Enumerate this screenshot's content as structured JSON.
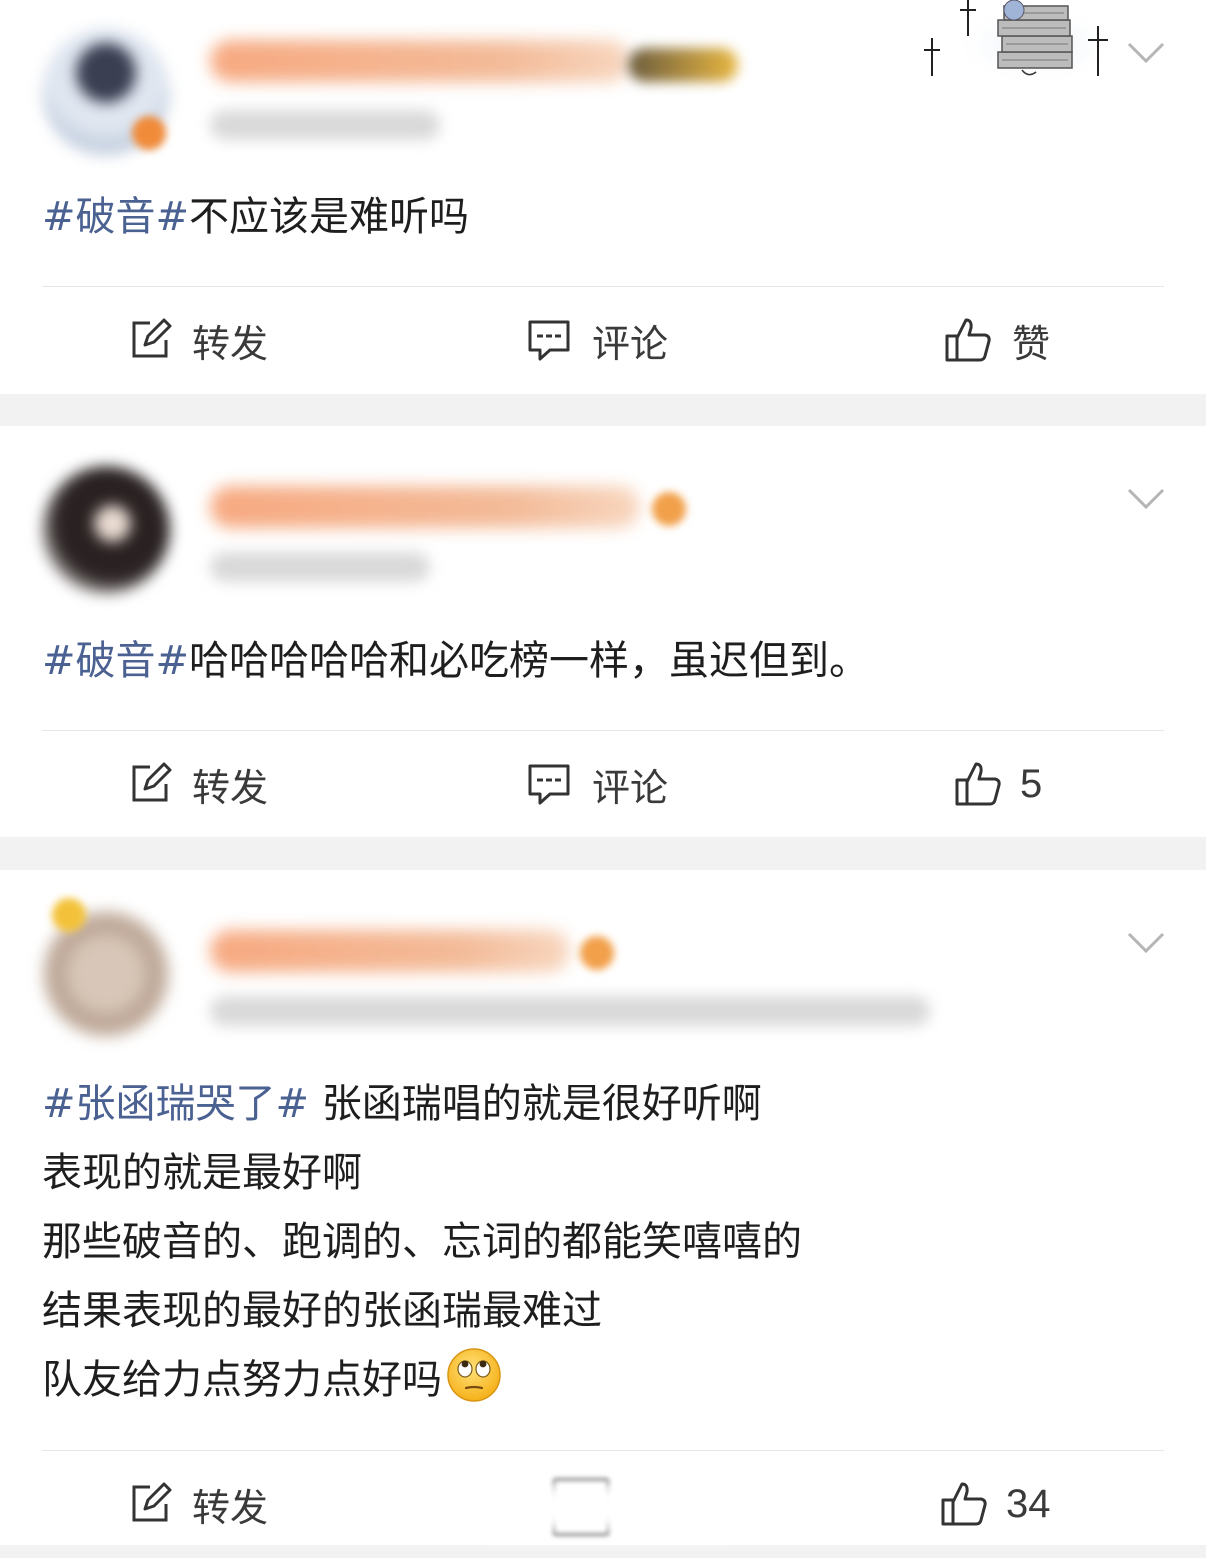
{
  "colors": {
    "hashtag": "#4a6192",
    "text": "#1e1e1e",
    "action_text": "#3a3a3a",
    "separator": "#f2f2f2",
    "divider": "#e6e6e6"
  },
  "posts": [
    {
      "content_lines": [
        [
          {
            "type": "hashtag",
            "text": "#破音#"
          },
          {
            "type": "text",
            "text": "不应该是难听吗"
          }
        ]
      ],
      "actions": {
        "repost_label": "转发",
        "comment_label": "评论",
        "like_label": "赞",
        "repost_icon": "repost-icon",
        "comment_icon": "comment-icon",
        "like_icon": "thumbs-up-icon"
      },
      "decoration_icon": "book-stack-badge-icon",
      "menu_icon": "chevron-down-icon"
    },
    {
      "content_lines": [
        [
          {
            "type": "hashtag",
            "text": "#破音#"
          },
          {
            "type": "text",
            "text": "哈哈哈哈哈和必吃榜一样，虽迟但到。"
          }
        ]
      ],
      "actions": {
        "repost_label": "转发",
        "comment_label": "评论",
        "like_count": "5",
        "repost_icon": "repost-icon",
        "comment_icon": "comment-icon",
        "like_icon": "thumbs-up-icon"
      },
      "menu_icon": "chevron-down-icon"
    },
    {
      "content_lines": [
        [
          {
            "type": "hashtag",
            "text": "#张函瑞哭了#"
          },
          {
            "type": "text",
            "text": " 张函瑞唱的就是很好听啊"
          }
        ],
        [
          {
            "type": "text",
            "text": "表现的就是最好啊"
          }
        ],
        [
          {
            "type": "text",
            "text": "那些破音的、跑调的、忘词的都能笑嘻嘻的"
          }
        ],
        [
          {
            "type": "text",
            "text": "结果表现的最好的张函瑞最难过"
          }
        ],
        [
          {
            "type": "text",
            "text": "队友给力点努力点好吗"
          },
          {
            "type": "emoji",
            "name": "eye-roll-emoji-icon"
          }
        ]
      ],
      "actions": {
        "repost_label": "转发",
        "like_count": "34",
        "repost_icon": "repost-icon",
        "comment_icon": "comment-icon",
        "like_icon": "thumbs-up-icon"
      },
      "menu_icon": "chevron-down-icon"
    }
  ]
}
